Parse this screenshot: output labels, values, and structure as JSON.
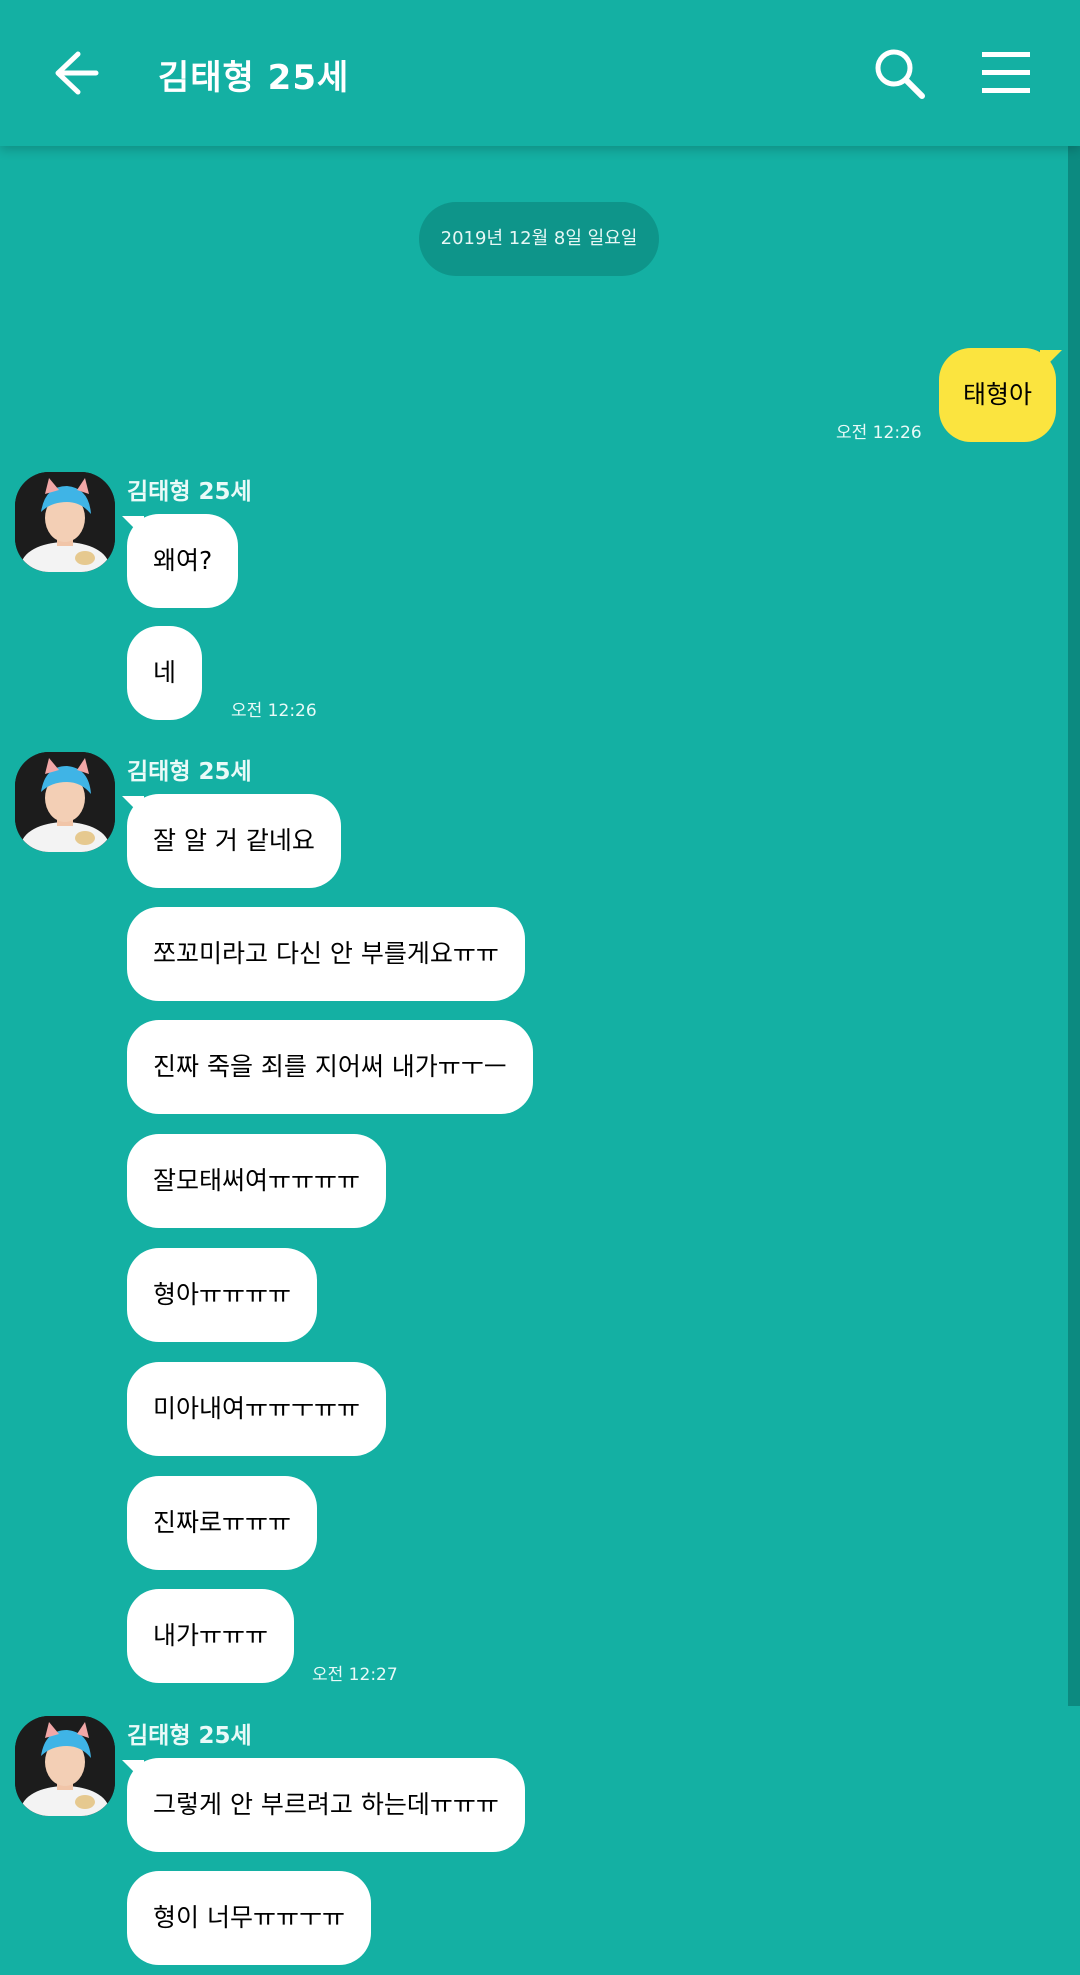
{
  "header": {
    "back_icon": "arrow-left-icon",
    "title": "김태형 25세",
    "search_icon": "search-icon",
    "menu_icon": "hamburger-menu-icon"
  },
  "date_divider": "2019년 12월 8일 일요일",
  "colors": {
    "background": "#14b0a3",
    "my_bubble": "#fbe43f",
    "their_bubble": "#ffffff"
  },
  "messages": {
    "m1": {
      "text": "태형아",
      "time": "오전 12:26"
    },
    "g1": {
      "sender": "김태형 25세",
      "items": [
        "왜여?",
        "네"
      ],
      "time": "오전 12:26"
    },
    "g2": {
      "sender": "김태형 25세",
      "items": [
        "잘 알 거 같네요",
        "쪼꼬미라고 다신 안 부를게요ㅠㅠ",
        "진짜 죽을 죄를 지어써 내가ㅠㅜㅡ",
        "잘모태써여ㅠㅠㅠㅠ",
        "형아ㅠㅠㅠㅠ",
        "미아내여ㅠㅠㅜㅠㅠ",
        "진짜로ㅠㅠㅠ",
        "내가ㅠㅠㅠ"
      ],
      "time": "오전 12:27"
    },
    "g3": {
      "sender": "김태형 25세",
      "items": [
        "그렇게 안 부르려고 하는데ㅠㅠㅠ",
        "형이 너무ㅠㅠㅜㅠ"
      ]
    }
  }
}
